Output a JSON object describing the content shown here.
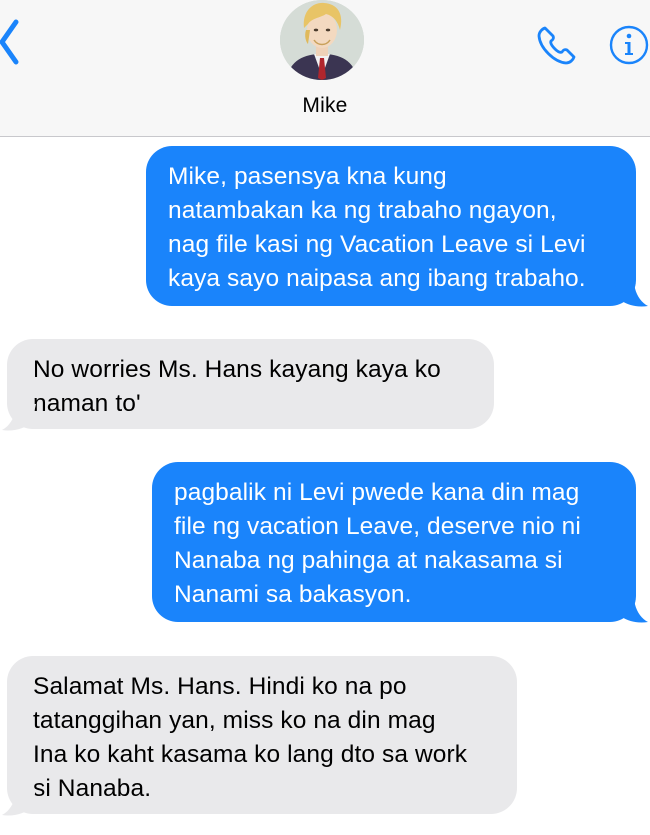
{
  "header": {
    "contact_name": "Mike",
    "back_icon": "chevron-left-icon",
    "call_icon": "phone-icon",
    "info_icon": "info-icon",
    "accent_color": "#1a84fb"
  },
  "messages": [
    {
      "direction": "outgoing",
      "text": "Mike, pasensya kna kung\nnatambakan ka ng trabaho ngayon,\nnag file kasi ng Vacation Leave si Levi\nkaya sayo naipasa ang ibang trabaho."
    },
    {
      "direction": "incoming",
      "text": "No worries Ms. Hans kayang kaya ko\nnaman to'"
    },
    {
      "direction": "outgoing",
      "text": "pagbalik ni Levi pwede kana din mag\nfile ng vacation Leave, deserve nio ni\nNanaba ng pahinga at nakasama si\nNanami sa bakasyon."
    },
    {
      "direction": "incoming",
      "text": "Salamat Ms. Hans. Hindi ko na po\ntatanggihan yan, miss ko na din mag\nIna ko kaht kasama ko lang dto sa work\nsi Nanaba."
    }
  ],
  "colors": {
    "outgoing_bubble": "#1a84fb",
    "incoming_bubble": "#e9e9eb"
  }
}
